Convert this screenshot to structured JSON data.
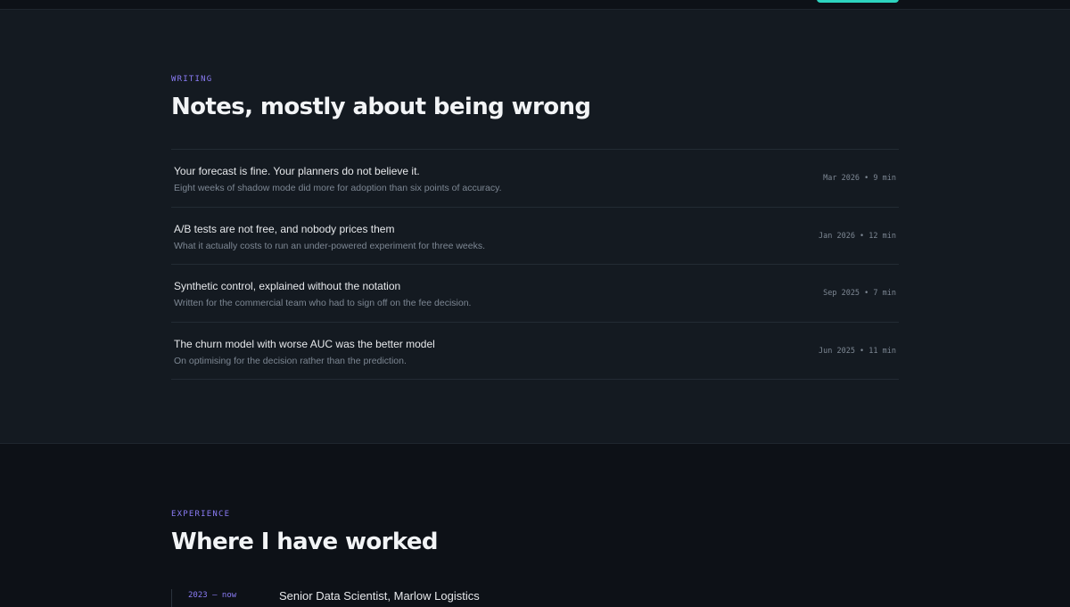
{
  "writing": {
    "eyebrow": "WRITING",
    "heading": "Notes, mostly about being wrong",
    "posts": [
      {
        "title": "Your forecast is fine. Your planners do not believe it.",
        "summary": "Eight weeks of shadow mode did more for adoption than six points of accuracy.",
        "meta": "Mar 2026 • 9 min"
      },
      {
        "title": "A/B tests are not free, and nobody prices them",
        "summary": "What it actually costs to run an under-powered experiment for three weeks.",
        "meta": "Jan 2026 • 12 min"
      },
      {
        "title": "Synthetic control, explained without the notation",
        "summary": "Written for the commercial team who had to sign off on the fee decision.",
        "meta": "Sep 2025 • 7 min"
      },
      {
        "title": "The churn model with worse AUC was the better model",
        "summary": "On optimising for the decision rather than the prediction.",
        "meta": "Jun 2025 • 11 min"
      }
    ]
  },
  "experience": {
    "eyebrow": "EXPERIENCE",
    "heading": "Where I have worked",
    "jobs": [
      {
        "dates": "2023 — now",
        "role": "Senior Data Scientist, Marlow Logistics"
      }
    ]
  },
  "colors": {
    "accent": "#2dd4bf",
    "eyebrow": "#8b7cf6",
    "background": "#0d1117",
    "panel": "#141a21"
  }
}
